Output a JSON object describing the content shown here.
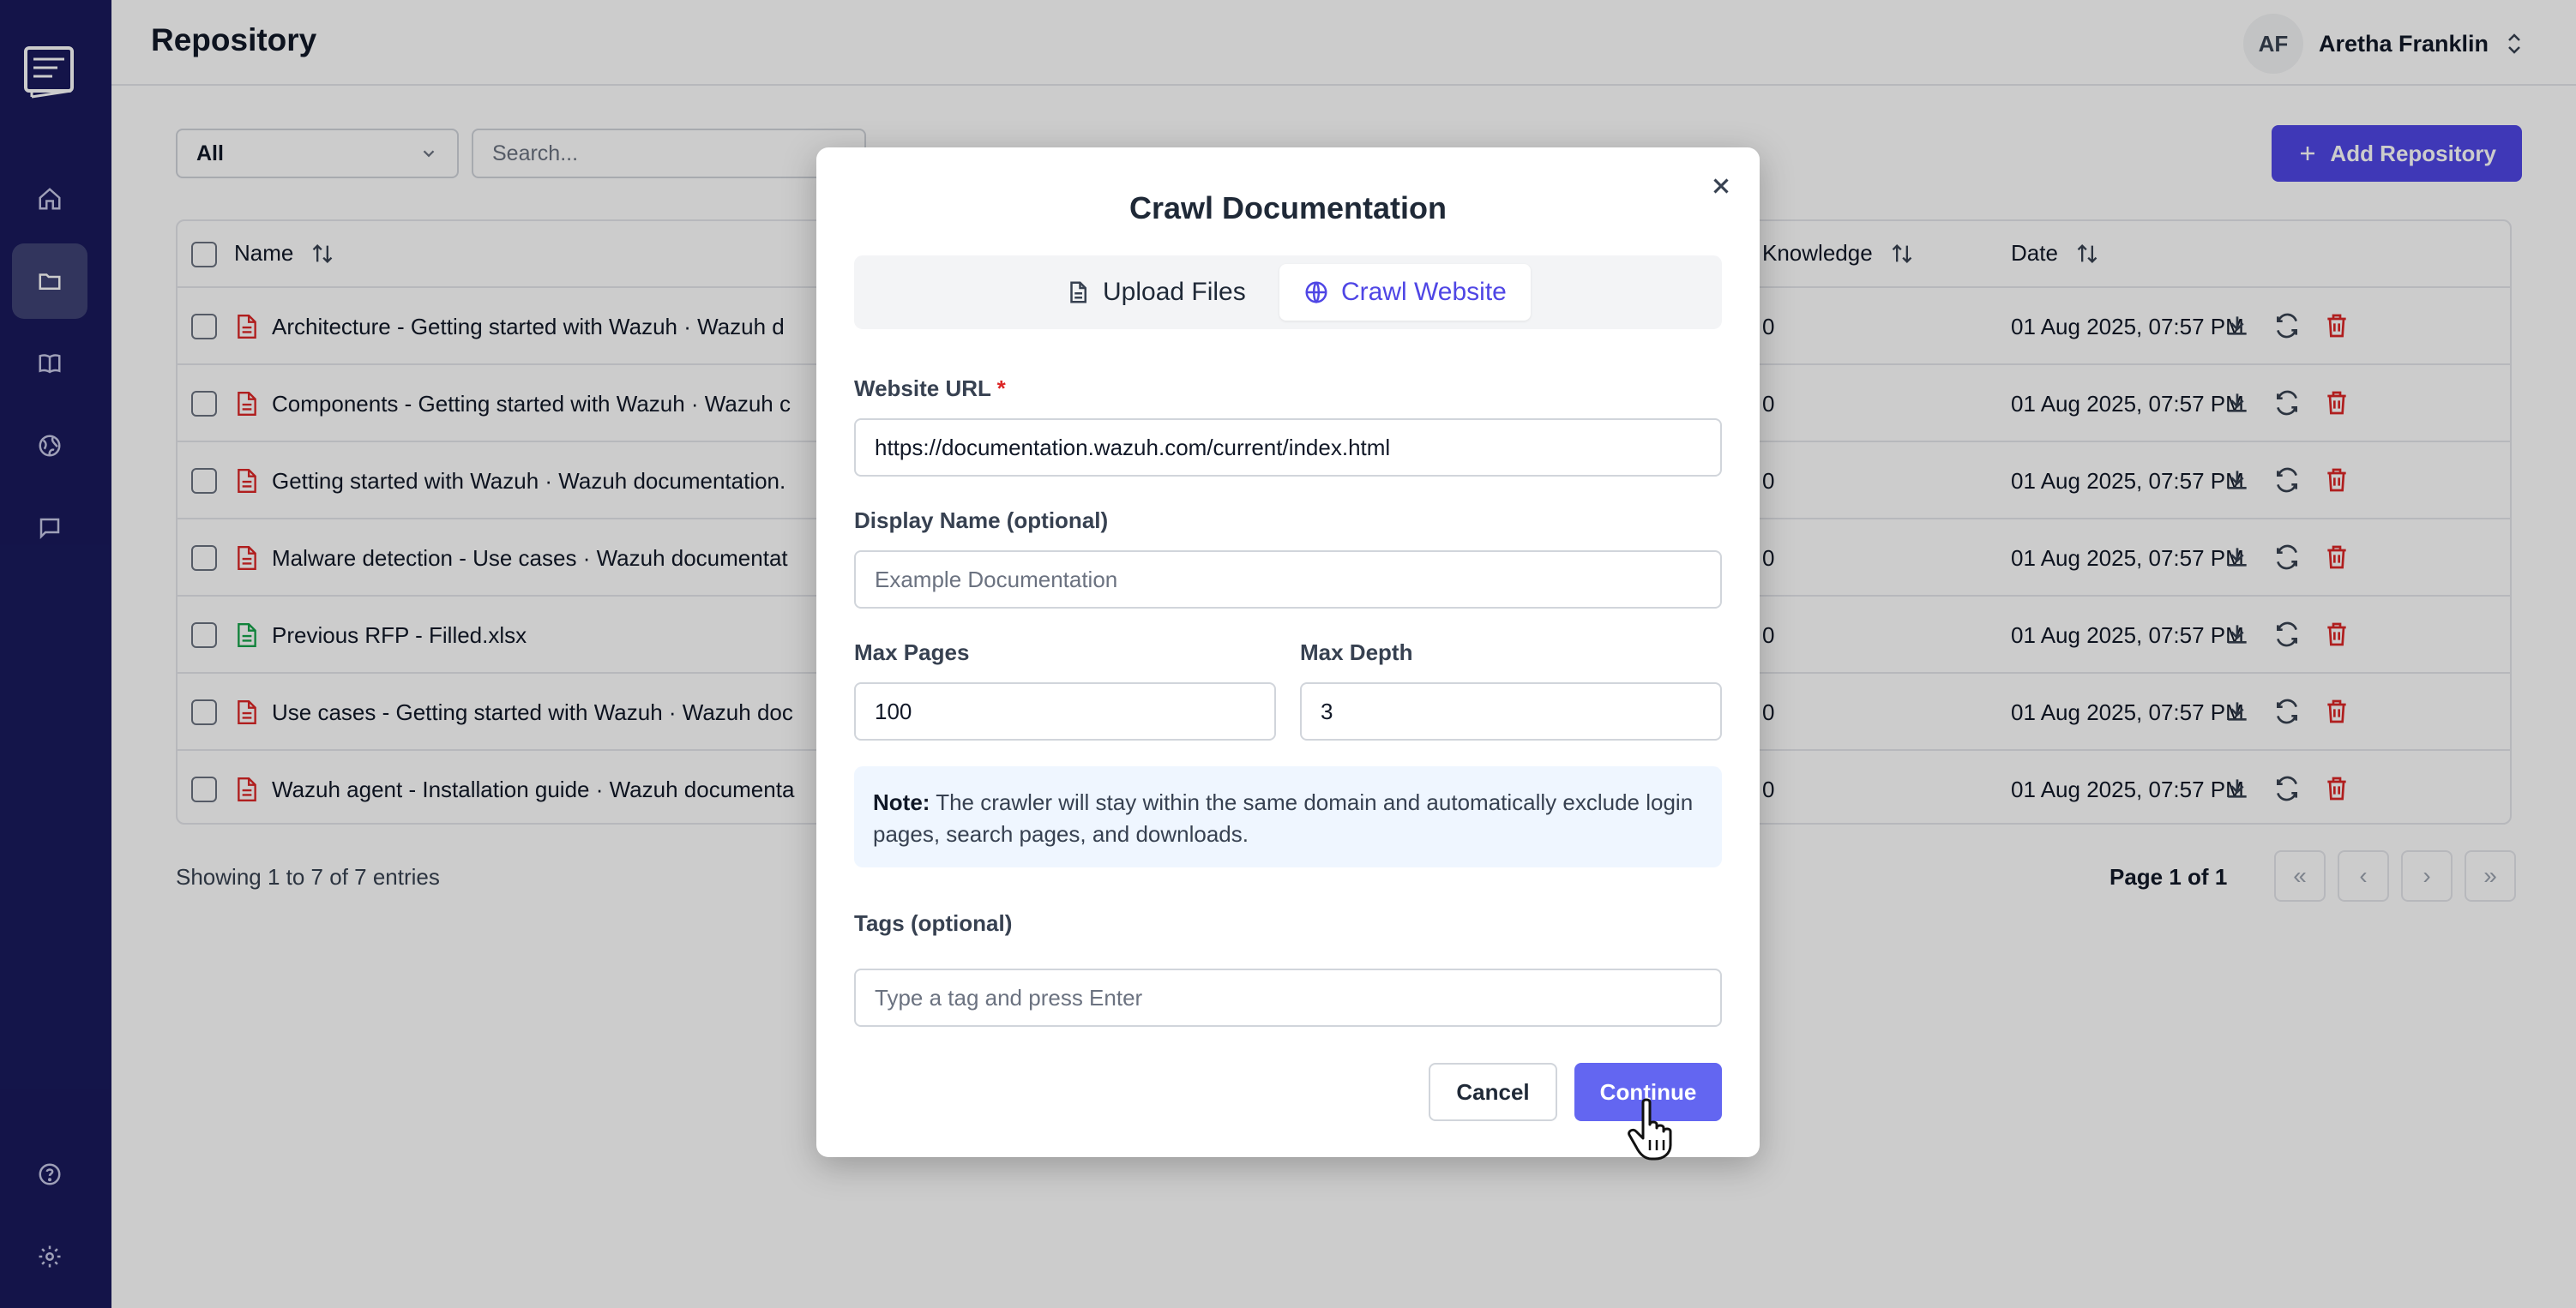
{
  "header": {
    "title": "Repository",
    "user": {
      "initials": "AF",
      "name": "Aretha Franklin"
    }
  },
  "sidebar": {
    "items": [
      {
        "icon": "home-icon"
      },
      {
        "icon": "folder-icon",
        "active": true
      },
      {
        "icon": "book-icon"
      },
      {
        "icon": "globe-icon"
      },
      {
        "icon": "chat-icon"
      },
      {
        "icon": "help-icon"
      },
      {
        "icon": "gear-icon"
      }
    ]
  },
  "toolbar": {
    "filter_value": "All",
    "search_placeholder": "Search...",
    "add_label": "Add Repository"
  },
  "table": {
    "columns": {
      "name": "Name",
      "knowledge": "Knowledge",
      "date": "Date"
    },
    "rows": [
      {
        "name": "Architecture - Getting started with Wazuh · Wazuh d",
        "knowledge": "0",
        "date": "01 Aug 2025, 07:57 PM",
        "type": "pdf"
      },
      {
        "name": "Components - Getting started with Wazuh · Wazuh c",
        "knowledge": "0",
        "date": "01 Aug 2025, 07:57 PM",
        "type": "pdf"
      },
      {
        "name": "Getting started with Wazuh · Wazuh documentation.",
        "knowledge": "0",
        "date": "01 Aug 2025, 07:57 PM",
        "type": "pdf"
      },
      {
        "name": "Malware detection - Use cases · Wazuh documentat",
        "knowledge": "0",
        "date": "01 Aug 2025, 07:57 PM",
        "type": "pdf"
      },
      {
        "name": "Previous RFP - Filled.xlsx",
        "knowledge": "0",
        "date": "01 Aug 2025, 07:57 PM",
        "type": "xlsx"
      },
      {
        "name": "Use cases - Getting started with Wazuh · Wazuh doc",
        "knowledge": "0",
        "date": "01 Aug 2025, 07:57 PM",
        "type": "pdf"
      },
      {
        "name": "Wazuh agent - Installation guide · Wazuh documenta",
        "knowledge": "0",
        "date": "01 Aug 2025, 07:57 PM",
        "type": "pdf"
      }
    ]
  },
  "footer": {
    "showing": "Showing 1 to 7 of 7 entries",
    "page_info": "Page 1 of 1"
  },
  "modal": {
    "title": "Crawl Documentation",
    "tabs": {
      "upload": "Upload Files",
      "crawl": "Crawl Website"
    },
    "url_label": "Website URL",
    "url_required": "*",
    "url_value": "https://documentation.wazuh.com/current/index.html",
    "display_label": "Display Name (optional)",
    "display_placeholder": "Example Documentation",
    "max_pages_label": "Max Pages",
    "max_pages_value": "100",
    "max_depth_label": "Max Depth",
    "max_depth_value": "3",
    "note_bold": "Note:",
    "note_text": " The crawler will stay within the same domain and automatically exclude login pages, search pages, and downloads.",
    "tags_label": "Tags (optional)",
    "tags_placeholder": "Type a tag and press Enter",
    "cancel_label": "Cancel",
    "continue_label": "Continue"
  },
  "colors": {
    "sidebar_bg": "#191a5c",
    "accent": "#4f46e5",
    "pdf_icon": "#dc2626",
    "xlsx_icon": "#16a34a",
    "note_bg": "#eff6ff"
  }
}
